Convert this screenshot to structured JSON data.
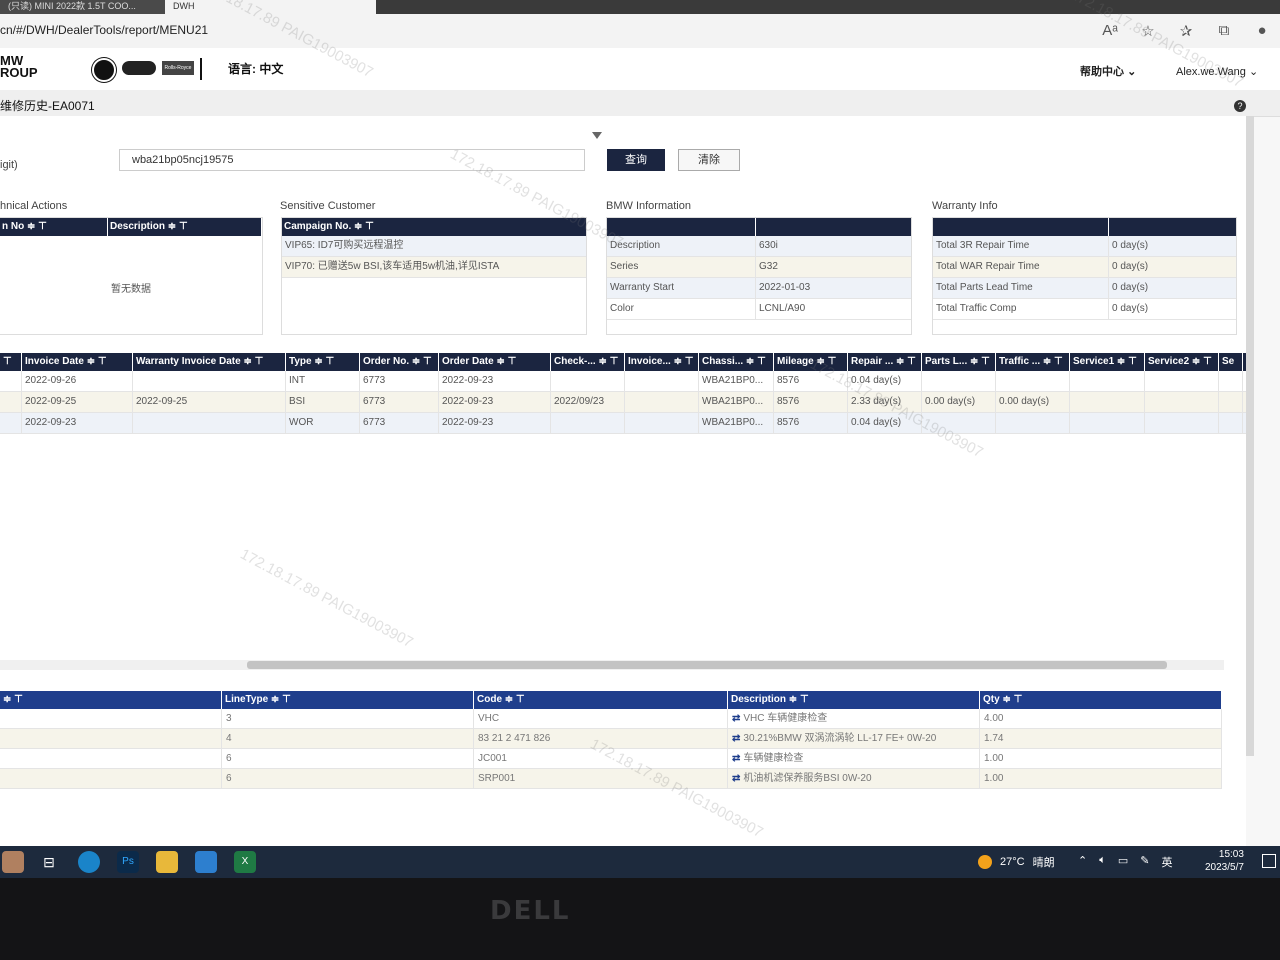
{
  "browser": {
    "tabs": [
      "(只读) MINI 2022款 1.5T COO...",
      "DWH"
    ],
    "url": "cn/#/DWH/DealerTools/report/MENU21"
  },
  "header": {
    "logo_text_line1": "MW",
    "logo_text_line2": "ROUP",
    "rr_logo_text": "Rolls-Royce",
    "language": "语言: 中文",
    "help_center": "帮助中心",
    "user": "Alex.we.Wang"
  },
  "page": {
    "title": "维修历史-EA0071",
    "help_icon": "?"
  },
  "search": {
    "label": "igit)",
    "value": "wba21bp05ncj19575",
    "query_label": "查询",
    "clear_label": "清除"
  },
  "technical_actions": {
    "title": "hnical Actions",
    "columns": [
      "n No ≑ ⊤",
      "Description ≑ ⊤"
    ],
    "empty_text": "暂无数据"
  },
  "sensitive_customer": {
    "title": "Sensitive Customer",
    "columns": [
      "Campaign No. ≑ ⊤"
    ],
    "rows": [
      "VIP65: ID7可购买远程温控",
      "VIP70: 已赠送5w BSI,该车适用5w机油,详见ISTA"
    ]
  },
  "bmw_information": {
    "title": "BMW Information",
    "rows": [
      [
        "Description",
        "630i"
      ],
      [
        "Series",
        "G32"
      ],
      [
        "Warranty Start",
        "2022-01-03"
      ],
      [
        "Color",
        "LCNL/A90"
      ]
    ]
  },
  "warranty_info": {
    "title": "Warranty Info",
    "rows": [
      [
        "Total 3R Repair Time",
        "0 day(s)"
      ],
      [
        "Total WAR Repair Time",
        "0 day(s)"
      ],
      [
        "Total Parts Lead Time",
        "0 day(s)"
      ],
      [
        "Total Traffic Comp",
        "0 day(s)"
      ]
    ]
  },
  "main_grid": {
    "columns": [
      "⊤",
      "Invoice Date ≑ ⊤",
      "Warranty Invoice Date ≑ ⊤",
      "Type ≑ ⊤",
      "Order No. ≑ ⊤",
      "Order Date ≑ ⊤",
      "Check-... ≑ ⊤",
      "Invoice... ≑ ⊤",
      "Chassi... ≑ ⊤",
      "Mileage ≑ ⊤",
      "Repair ... ≑ ⊤",
      "Parts L... ≑ ⊤",
      "Traffic ... ≑ ⊤",
      "Service1 ≑ ⊤",
      "Service2 ≑ ⊤",
      "Se"
    ],
    "rows": [
      [
        "",
        "2022-09-26",
        "",
        "INT",
        "6773",
        "2022-09-23",
        "",
        "",
        "WBA21BP0...",
        "8576",
        "0.04 day(s)",
        "",
        "",
        "",
        "",
        ""
      ],
      [
        "",
        "2022-09-25",
        "2022-09-25",
        "BSI",
        "6773",
        "2022-09-23",
        "2022/09/23",
        "",
        "WBA21BP0...",
        "8576",
        "2.33 day(s)",
        "0.00 day(s)",
        "0.00 day(s)",
        "",
        "",
        ""
      ],
      [
        "",
        "2022-09-23",
        "",
        "WOR",
        "6773",
        "2022-09-23",
        "",
        "",
        "WBA21BP0...",
        "8576",
        "0.04 day(s)",
        "",
        "",
        "",
        "",
        ""
      ]
    ]
  },
  "line_grid": {
    "columns": [
      "≑ ⊤",
      "LineType ≑ ⊤",
      "Code ≑ ⊤",
      "Description ≑ ⊤",
      "Qty ≑ ⊤"
    ],
    "rows": [
      [
        "",
        "3",
        "VHC",
        "VHC 车辆健康检查",
        "4.00"
      ],
      [
        "",
        "4",
        "83 21 2 471 826",
        "30.21%BMW 双涡流涡轮 LL-17 FE+ 0W-20",
        "1.74"
      ],
      [
        "",
        "6",
        "JC001",
        "车辆健康检查",
        "1.00"
      ],
      [
        "",
        "6",
        "SRP001",
        "机油机滤保养服务BSI 0W-20",
        "1.00"
      ]
    ]
  },
  "taskbar": {
    "temperature": "27°C",
    "weather": "晴朗",
    "ime": "英",
    "time": "15:03",
    "date": "2023/5/7"
  },
  "monitor": {
    "brand": "DELL"
  },
  "watermark": {
    "text": "172.18.17.89 PAIG19003907"
  },
  "colors": {
    "header_navy": "#1b2540",
    "line_header_blue": "#1f3e8c",
    "taskbar": "#1d2a3d"
  }
}
